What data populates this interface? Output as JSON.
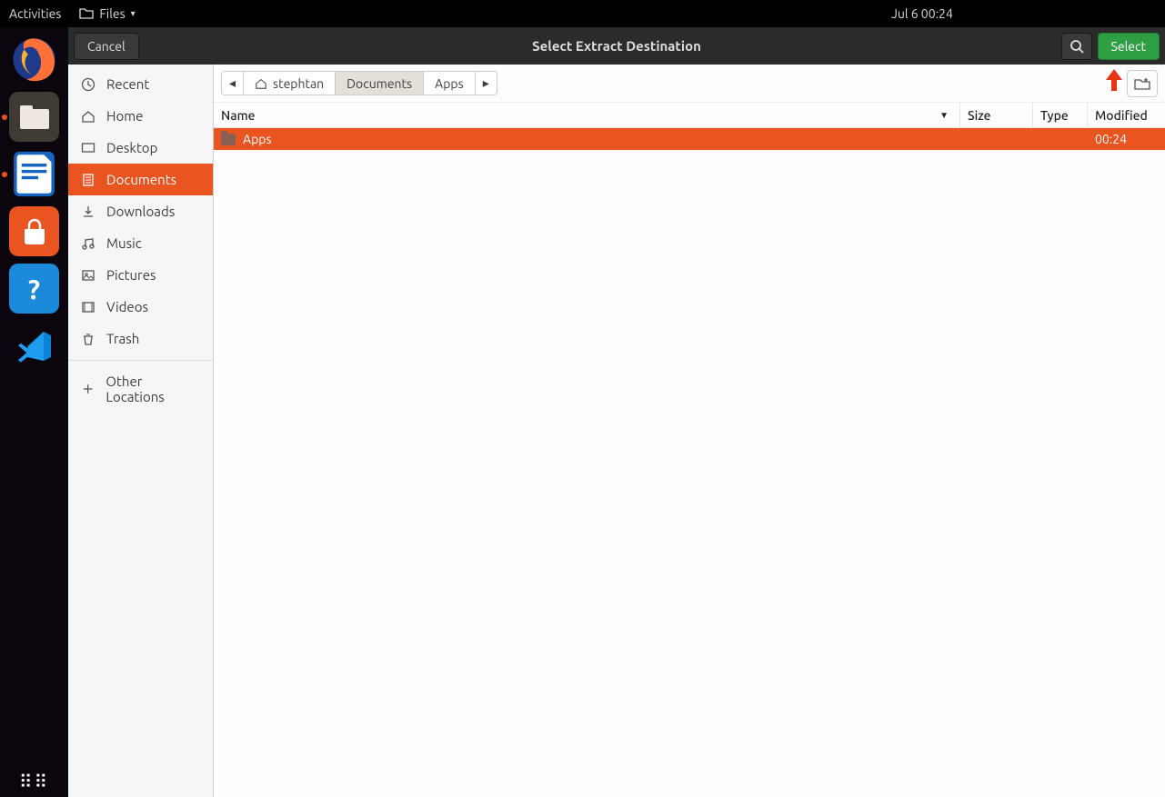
{
  "top_panel": {
    "activities": "Activities",
    "app_menu": "Files",
    "date": "Jul 6  00:24"
  },
  "header": {
    "cancel": "Cancel",
    "title": "Select Extract Destination",
    "select": "Select"
  },
  "sidebar": {
    "items": [
      {
        "label": "Recent"
      },
      {
        "label": "Home"
      },
      {
        "label": "Desktop"
      },
      {
        "label": "Documents"
      },
      {
        "label": "Downloads"
      },
      {
        "label": "Music"
      },
      {
        "label": "Pictures"
      },
      {
        "label": "Videos"
      },
      {
        "label": "Trash"
      },
      {
        "label": "Other Locations"
      }
    ]
  },
  "breadcrumb": {
    "seg1": "stephtan",
    "seg2": "Documents",
    "seg3": "Apps"
  },
  "columns": {
    "name": "Name",
    "size": "Size",
    "type": "Type",
    "modified": "Modified"
  },
  "files": [
    {
      "name": "Apps",
      "size": "",
      "type": "",
      "modified": "00:24"
    }
  ]
}
